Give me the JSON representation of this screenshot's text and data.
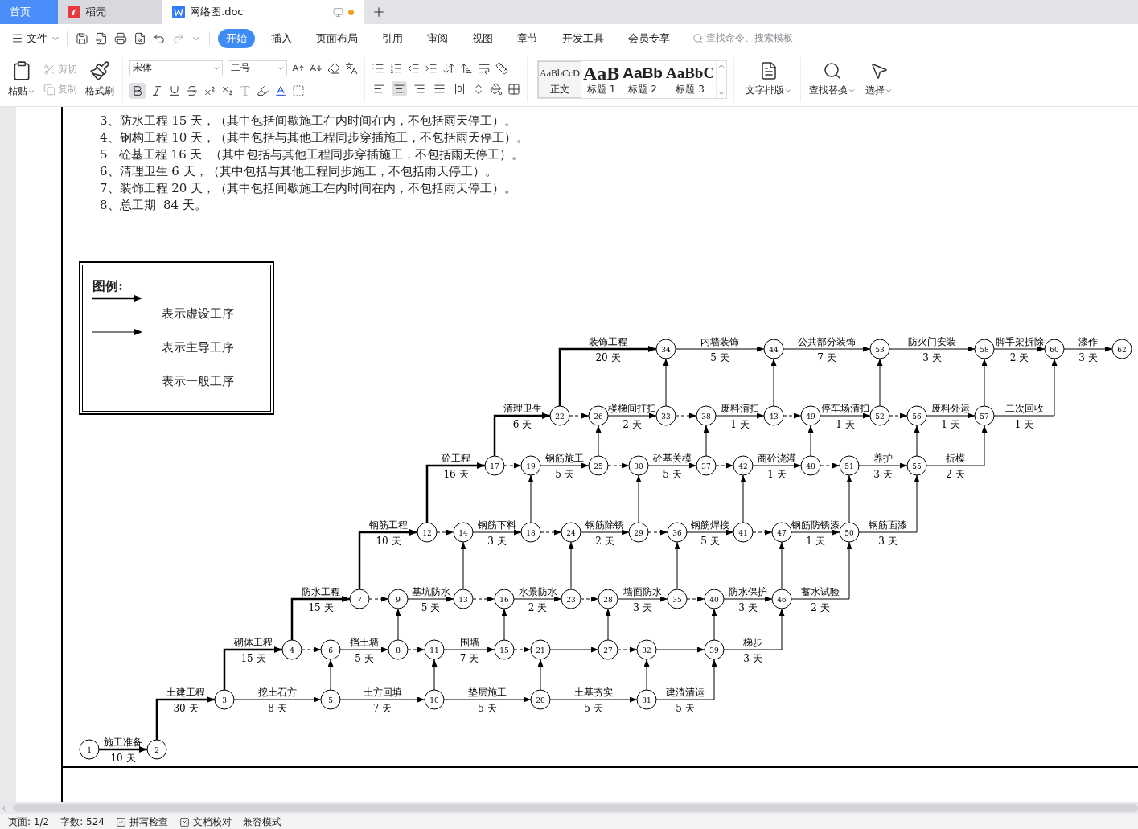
{
  "tabs": [
    {
      "kind": "home",
      "label": "首页",
      "selected": false
    },
    {
      "kind": "app",
      "label": "稻壳",
      "selected": false
    },
    {
      "kind": "doc",
      "label": "网络图.doc",
      "selected": true,
      "unsaved": true
    }
  ],
  "menu": {
    "file": "文件",
    "tabs": [
      {
        "label": "开始",
        "selected": true
      },
      {
        "label": "插入",
        "selected": false
      },
      {
        "label": "页面布局",
        "selected": false
      },
      {
        "label": "引用",
        "selected": false
      },
      {
        "label": "审阅",
        "selected": false
      },
      {
        "label": "视图",
        "selected": false
      },
      {
        "label": "章节",
        "selected": false
      },
      {
        "label": "开发工具",
        "selected": false
      },
      {
        "label": "会员专享",
        "selected": false
      }
    ],
    "search": {
      "placeholder": "查找命令、搜索模板"
    }
  },
  "ribbon": {
    "paste": "粘贴",
    "cut": {
      "label": "剪切",
      "disabled": true
    },
    "copy": {
      "label": "复制",
      "disabled": true
    },
    "format_painter": "格式刷",
    "font": "宋体",
    "font_size": "二号",
    "bold": {
      "active": true
    },
    "alignment": [
      {
        "kind": "left",
        "selected": false
      },
      {
        "kind": "center",
        "selected": true
      },
      {
        "kind": "right",
        "selected": false
      },
      {
        "kind": "justify",
        "selected": false
      },
      {
        "kind": "distributed",
        "selected": false
      }
    ],
    "styles": [
      {
        "kind": "body",
        "preview": "AaBbCcD",
        "label": "正文",
        "selected": true
      },
      {
        "kind": "h1",
        "preview": "AaB",
        "label": "标题 1",
        "selected": false
      },
      {
        "kind": "h2",
        "preview": "AaBb",
        "label": "标题 2",
        "selected": false
      },
      {
        "kind": "h3",
        "preview": "AaBbC",
        "label": "标题 3",
        "selected": false
      }
    ],
    "text_layout": "文字排版",
    "find_replace": "查找替换",
    "select": "选择"
  },
  "document": {
    "lines": [
      "3、防水工程 15 天，（其中包括间歇施工在内时间在内，不包括雨天停工）。",
      "4、钢构工程 10 天，（其中包括与其他工程同步穿插施工，不包括雨天停工）。",
      "5   砼基工程 16 天  （其中包括与其他工程同步穿插施工，不包括雨天停工）。",
      "6、清理卫生 6 天，（其中包括与其他工程同步施工，不包括雨天停工）。",
      "7、装饰工程 20 天，（其中包括间歇施工在内时间在内，不包括雨天停工）。",
      "8、总工期  84 天。"
    ],
    "legend": {
      "title": "图例:",
      "items": [
        {
          "kind": "main",
          "label": "表示虚设工序"
        },
        {
          "kind": "normal",
          "label": "表示主导工序"
        },
        {
          "kind": "none",
          "label": "表示一般工序"
        }
      ]
    },
    "network": {
      "nodes": [
        {
          "label": "1"
        },
        {
          "label": "2"
        },
        {
          "label": "3"
        },
        {
          "label": "4"
        },
        {
          "label": "5"
        },
        {
          "label": "6"
        },
        {
          "label": "7"
        },
        {
          "label": "8"
        },
        {
          "label": "9"
        },
        {
          "label": "10"
        },
        {
          "label": "11"
        },
        {
          "label": "12"
        },
        {
          "label": "13"
        },
        {
          "label": "14"
        },
        {
          "label": "15"
        },
        {
          "label": "16"
        },
        {
          "label": "17"
        },
        {
          "label": "18"
        },
        {
          "label": "19"
        },
        {
          "label": "20"
        },
        {
          "label": "21"
        },
        {
          "label": "22"
        },
        {
          "label": "23"
        },
        {
          "label": "24"
        },
        {
          "label": "25"
        },
        {
          "label": "26"
        },
        {
          "label": "27"
        },
        {
          "label": "28"
        },
        {
          "label": "29"
        },
        {
          "label": "30"
        },
        {
          "label": "31"
        },
        {
          "label": "32"
        },
        {
          "label": "33"
        },
        {
          "label": "34"
        },
        {
          "label": "35"
        },
        {
          "label": "36"
        },
        {
          "label": "37"
        },
        {
          "label": "38"
        },
        {
          "label": "39"
        },
        {
          "label": "40"
        },
        {
          "label": "41"
        },
        {
          "label": "42"
        },
        {
          "label": "43"
        },
        {
          "label": "44"
        },
        {
          "label": "46"
        },
        {
          "label": "47"
        },
        {
          "label": "48"
        },
        {
          "label": "49"
        },
        {
          "label": "50"
        },
        {
          "label": "51"
        },
        {
          "label": "52"
        },
        {
          "label": "53"
        },
        {
          "label": "55"
        },
        {
          "label": "56"
        },
        {
          "label": "57"
        },
        {
          "label": "58"
        },
        {
          "label": "60"
        },
        {
          "label": "62"
        }
      ],
      "edges": [
        {
          "kind": "main",
          "activity": "施工准备",
          "duration": "10 天"
        },
        {
          "kind": "main",
          "activity": "土建工程",
          "duration": "30 天"
        },
        {
          "kind": "main",
          "activity": "砌体工程",
          "duration": "15 天"
        },
        {
          "kind": "main",
          "activity": "防水工程",
          "duration": "15 天"
        },
        {
          "kind": "main",
          "activity": "钢筋工程",
          "duration": "10 天"
        },
        {
          "kind": "main",
          "activity": "砼工程",
          "duration": "16 天"
        },
        {
          "kind": "main",
          "activity": "清理卫生",
          "duration": "6 天"
        },
        {
          "kind": "main",
          "activity": "装饰工程",
          "duration": "20 天"
        },
        {
          "kind": "normal",
          "activity": "挖土石方",
          "duration": "8 天"
        },
        {
          "kind": "normal",
          "activity": "土方回填",
          "duration": "7 天"
        },
        {
          "kind": "normal",
          "activity": "垫层施工",
          "duration": "5 天"
        },
        {
          "kind": "normal",
          "activity": "土基夯实",
          "duration": "5 天"
        },
        {
          "kind": "normal",
          "activity": "建渣清运",
          "duration": "5 天"
        },
        {
          "kind": "normal",
          "activity": "挡土墙",
          "duration": "5 天"
        },
        {
          "kind": "normal",
          "activity": "围墙",
          "duration": "7 天"
        },
        {
          "kind": "normal",
          "activity": "梯步",
          "duration": "3 天"
        },
        {
          "kind": "normal",
          "activity": "基坑防水",
          "duration": "5 天"
        },
        {
          "kind": "normal",
          "activity": "水景防水",
          "duration": "2 天"
        },
        {
          "kind": "normal",
          "activity": "墙面防水",
          "duration": "3 天"
        },
        {
          "kind": "normal",
          "activity": "防水保护",
          "duration": "3 天"
        },
        {
          "kind": "normal",
          "activity": "蓄水试验",
          "duration": "2 天"
        },
        {
          "kind": "normal",
          "activity": "钢筋下料",
          "duration": "3 天"
        },
        {
          "kind": "normal",
          "activity": "钢筋除锈",
          "duration": "2 天"
        },
        {
          "kind": "normal",
          "activity": "钢筋焊接",
          "duration": "5 天"
        },
        {
          "kind": "normal",
          "activity": "钢筋防锈漆",
          "duration": "1 天"
        },
        {
          "kind": "normal",
          "activity": "钢筋面漆",
          "duration": "3 天"
        },
        {
          "kind": "normal",
          "activity": "钢筋施工",
          "duration": "5 天"
        },
        {
          "kind": "normal",
          "activity": "砼基关模",
          "duration": "5 天"
        },
        {
          "kind": "normal",
          "activity": "商砼浇灌",
          "duration": "1 天"
        },
        {
          "kind": "normal",
          "activity": "养护",
          "duration": "3 天"
        },
        {
          "kind": "normal",
          "activity": "折模",
          "duration": "2 天"
        },
        {
          "kind": "normal",
          "activity": "楼梯间打扫",
          "duration": "2 天"
        },
        {
          "kind": "normal",
          "activity": "废料清扫",
          "duration": "1 天"
        },
        {
          "kind": "normal",
          "activity": "停车场清扫",
          "duration": "1 天"
        },
        {
          "kind": "normal",
          "activity": "废料外运",
          "duration": "1 天"
        },
        {
          "kind": "normal",
          "activity": "二次回收",
          "duration": "1 天"
        },
        {
          "kind": "normal",
          "activity": "内墙装饰",
          "duration": "5 天"
        },
        {
          "kind": "normal",
          "activity": "公共部分装饰",
          "duration": "7 天"
        },
        {
          "kind": "normal",
          "activity": "防火门安装",
          "duration": "3 天"
        },
        {
          "kind": "normal",
          "activity": "脚手架拆除",
          "duration": "2 天"
        },
        {
          "kind": "normal",
          "activity": "漆作",
          "duration": "3 天"
        },
        {
          "kind": "normal"
        },
        {
          "kind": "normal"
        },
        {
          "kind": "dummy"
        },
        {
          "kind": "dummy"
        },
        {
          "kind": "dummy"
        },
        {
          "kind": "dummy"
        },
        {
          "kind": "dummy"
        },
        {
          "kind": "dummy"
        },
        {
          "kind": "dummy"
        },
        {
          "kind": "dummy"
        },
        {
          "kind": "dummy"
        },
        {
          "kind": "dummy"
        },
        {
          "kind": "dummy"
        },
        {
          "kind": "dummy"
        },
        {
          "kind": "dummy"
        },
        {
          "kind": "dummy"
        },
        {
          "kind": "dummy"
        },
        {
          "kind": "dummy"
        },
        {
          "kind": "dummy"
        },
        {
          "kind": "dummy"
        },
        {
          "kind": "dummy"
        },
        {
          "kind": "dummy"
        },
        {
          "kind": "normal"
        },
        {
          "kind": "normal"
        },
        {
          "kind": "normal"
        },
        {
          "kind": "normal"
        },
        {
          "kind": "normal"
        },
        {
          "kind": "normal"
        },
        {
          "kind": "normal"
        },
        {
          "kind": "normal"
        },
        {
          "kind": "normal"
        },
        {
          "kind": "normal"
        },
        {
          "kind": "normal"
        },
        {
          "kind": "normal"
        },
        {
          "kind": "normal"
        },
        {
          "kind": "normal"
        },
        {
          "kind": "normal"
        },
        {
          "kind": "normal"
        },
        {
          "kind": "normal"
        },
        {
          "kind": "normal"
        },
        {
          "kind": "normal"
        },
        {
          "kind": "normal"
        },
        {
          "kind": "normal"
        },
        {
          "kind": "normal"
        },
        {
          "kind": "normal"
        },
        {
          "kind": "normal"
        }
      ]
    }
  },
  "status_bar": {
    "page": "页面: 1/2",
    "words": "字数: 524",
    "spell_check": "拼写检查",
    "proofread": "文档校对",
    "compat": "兼容模式"
  }
}
